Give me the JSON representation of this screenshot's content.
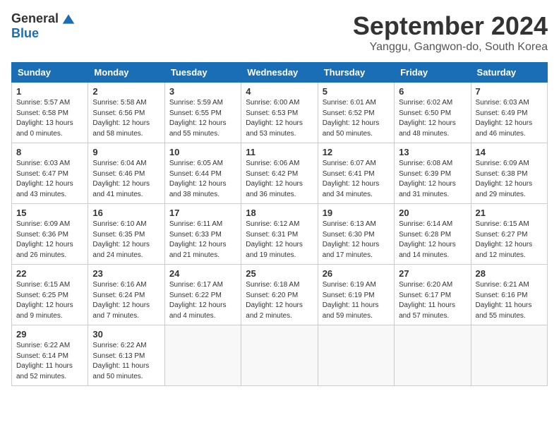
{
  "logo": {
    "general": "General",
    "blue": "Blue"
  },
  "title": "September 2024",
  "subtitle": "Yanggu, Gangwon-do, South Korea",
  "weekdays": [
    "Sunday",
    "Monday",
    "Tuesday",
    "Wednesday",
    "Thursday",
    "Friday",
    "Saturday"
  ],
  "weeks": [
    [
      {
        "day": 1,
        "sunrise": "5:57 AM",
        "sunset": "6:58 PM",
        "daylight": "13 hours and 0 minutes."
      },
      {
        "day": 2,
        "sunrise": "5:58 AM",
        "sunset": "6:56 PM",
        "daylight": "12 hours and 58 minutes."
      },
      {
        "day": 3,
        "sunrise": "5:59 AM",
        "sunset": "6:55 PM",
        "daylight": "12 hours and 55 minutes."
      },
      {
        "day": 4,
        "sunrise": "6:00 AM",
        "sunset": "6:53 PM",
        "daylight": "12 hours and 53 minutes."
      },
      {
        "day": 5,
        "sunrise": "6:01 AM",
        "sunset": "6:52 PM",
        "daylight": "12 hours and 50 minutes."
      },
      {
        "day": 6,
        "sunrise": "6:02 AM",
        "sunset": "6:50 PM",
        "daylight": "12 hours and 48 minutes."
      },
      {
        "day": 7,
        "sunrise": "6:03 AM",
        "sunset": "6:49 PM",
        "daylight": "12 hours and 46 minutes."
      }
    ],
    [
      {
        "day": 8,
        "sunrise": "6:03 AM",
        "sunset": "6:47 PM",
        "daylight": "12 hours and 43 minutes."
      },
      {
        "day": 9,
        "sunrise": "6:04 AM",
        "sunset": "6:46 PM",
        "daylight": "12 hours and 41 minutes."
      },
      {
        "day": 10,
        "sunrise": "6:05 AM",
        "sunset": "6:44 PM",
        "daylight": "12 hours and 38 minutes."
      },
      {
        "day": 11,
        "sunrise": "6:06 AM",
        "sunset": "6:42 PM",
        "daylight": "12 hours and 36 minutes."
      },
      {
        "day": 12,
        "sunrise": "6:07 AM",
        "sunset": "6:41 PM",
        "daylight": "12 hours and 34 minutes."
      },
      {
        "day": 13,
        "sunrise": "6:08 AM",
        "sunset": "6:39 PM",
        "daylight": "12 hours and 31 minutes."
      },
      {
        "day": 14,
        "sunrise": "6:09 AM",
        "sunset": "6:38 PM",
        "daylight": "12 hours and 29 minutes."
      }
    ],
    [
      {
        "day": 15,
        "sunrise": "6:09 AM",
        "sunset": "6:36 PM",
        "daylight": "12 hours and 26 minutes."
      },
      {
        "day": 16,
        "sunrise": "6:10 AM",
        "sunset": "6:35 PM",
        "daylight": "12 hours and 24 minutes."
      },
      {
        "day": 17,
        "sunrise": "6:11 AM",
        "sunset": "6:33 PM",
        "daylight": "12 hours and 21 minutes."
      },
      {
        "day": 18,
        "sunrise": "6:12 AM",
        "sunset": "6:31 PM",
        "daylight": "12 hours and 19 minutes."
      },
      {
        "day": 19,
        "sunrise": "6:13 AM",
        "sunset": "6:30 PM",
        "daylight": "12 hours and 17 minutes."
      },
      {
        "day": 20,
        "sunrise": "6:14 AM",
        "sunset": "6:28 PM",
        "daylight": "12 hours and 14 minutes."
      },
      {
        "day": 21,
        "sunrise": "6:15 AM",
        "sunset": "6:27 PM",
        "daylight": "12 hours and 12 minutes."
      }
    ],
    [
      {
        "day": 22,
        "sunrise": "6:15 AM",
        "sunset": "6:25 PM",
        "daylight": "12 hours and 9 minutes."
      },
      {
        "day": 23,
        "sunrise": "6:16 AM",
        "sunset": "6:24 PM",
        "daylight": "12 hours and 7 minutes."
      },
      {
        "day": 24,
        "sunrise": "6:17 AM",
        "sunset": "6:22 PM",
        "daylight": "12 hours and 4 minutes."
      },
      {
        "day": 25,
        "sunrise": "6:18 AM",
        "sunset": "6:20 PM",
        "daylight": "12 hours and 2 minutes."
      },
      {
        "day": 26,
        "sunrise": "6:19 AM",
        "sunset": "6:19 PM",
        "daylight": "11 hours and 59 minutes."
      },
      {
        "day": 27,
        "sunrise": "6:20 AM",
        "sunset": "6:17 PM",
        "daylight": "11 hours and 57 minutes."
      },
      {
        "day": 28,
        "sunrise": "6:21 AM",
        "sunset": "6:16 PM",
        "daylight": "11 hours and 55 minutes."
      }
    ],
    [
      {
        "day": 29,
        "sunrise": "6:22 AM",
        "sunset": "6:14 PM",
        "daylight": "11 hours and 52 minutes."
      },
      {
        "day": 30,
        "sunrise": "6:22 AM",
        "sunset": "6:13 PM",
        "daylight": "11 hours and 50 minutes."
      },
      null,
      null,
      null,
      null,
      null
    ]
  ]
}
